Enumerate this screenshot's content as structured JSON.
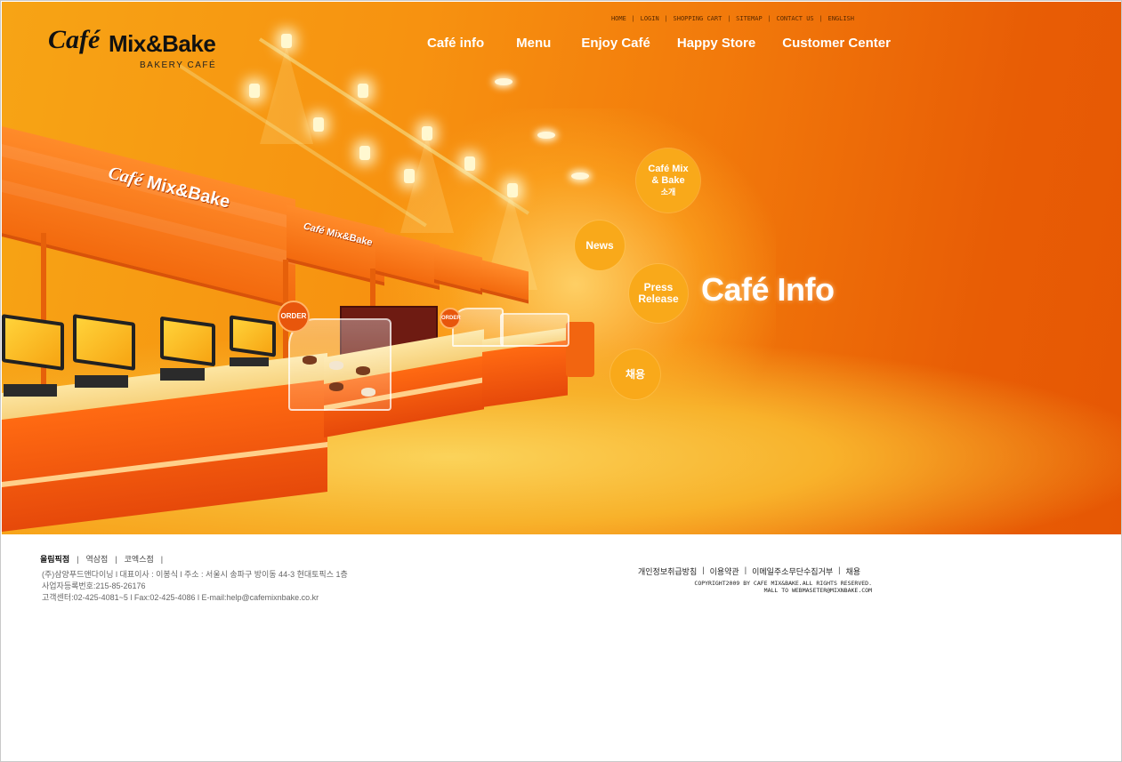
{
  "brand": {
    "cafe": "Café",
    "name": "Mix&Bake",
    "tagline": "BAKERY CAFÉ"
  },
  "util_nav": [
    "HOME",
    "LOGIN",
    "SHOPPING CART",
    "SITEMAP",
    "CONTACT US",
    "ENGLISH"
  ],
  "main_nav": [
    "Café info",
    "Menu",
    "Enjoy Café",
    "Happy Store",
    "Customer Center"
  ],
  "sub_menu": {
    "about_line1": "Café Mix",
    "about_line2": "& Bake",
    "about_line3": "소개",
    "news": "News",
    "press_line1": "Press",
    "press_line2": "Release",
    "recruit": "채용"
  },
  "section_title": "Café Info",
  "scene": {
    "canopy_brand": "Mix&Bake",
    "canopy_cafe": "Café",
    "order_sign": "ORDER"
  },
  "footer": {
    "branches": [
      "올림픽점",
      "역삼점",
      "코엑스점"
    ],
    "company_line1": "(주)삼양푸드앤다이닝 l 대표이사 : 이봉식 l 주소 : 서울시 송파구 방이동 44-3 현대토픽스 1층",
    "company_line2": "사업자등록번호:215-85-26176",
    "company_line3": "고객센터:02-425-4081~5 l Fax:02-425-4086 l E-mail:help@cafemixnbake.co.kr",
    "links": [
      "개인정보취급방침",
      "이용약관",
      "이메일주소무단수집거부",
      "채용"
    ],
    "copyright": "COPYRIGHT2009 BY CAFE MIX&BAKE.ALL RIGHTS RESERVED.",
    "mail": "MALL TO WEBMASETER@MIXNBAKE.COM"
  }
}
